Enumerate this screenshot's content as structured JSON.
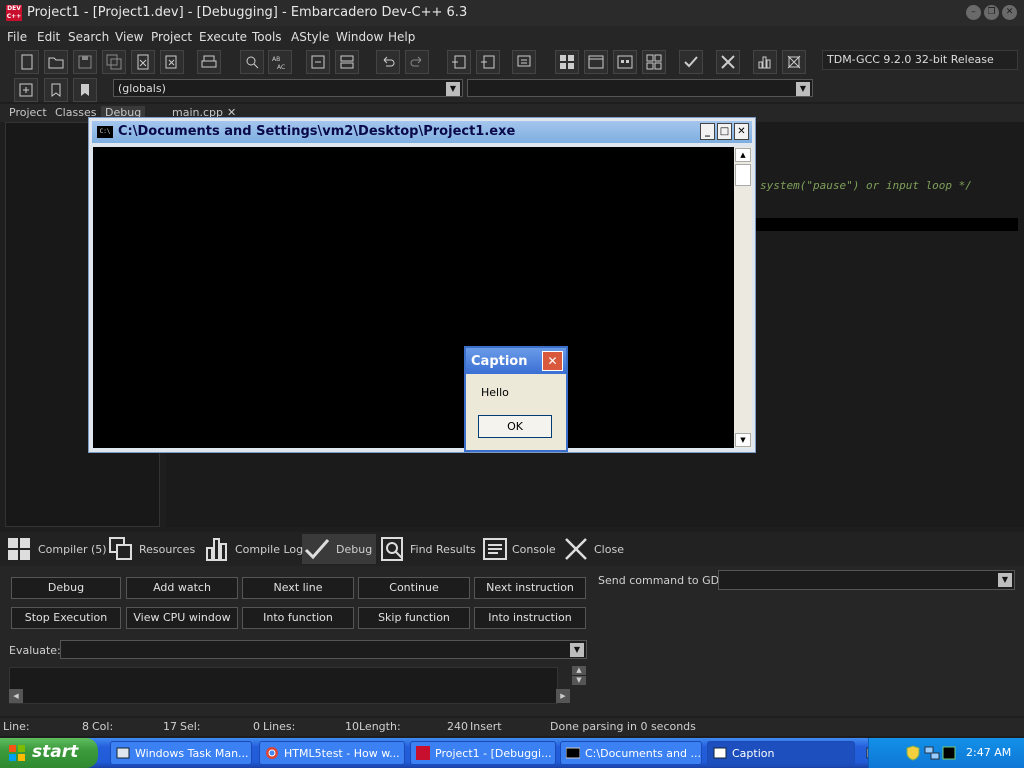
{
  "window": {
    "title": "Project1 - [Project1.dev] - [Debugging] - Embarcadero Dev-C++ 6.3",
    "app_icon_text": "DEV C++"
  },
  "menu": [
    "File",
    "Edit",
    "Search",
    "View",
    "Project",
    "Execute",
    "Tools",
    "AStyle",
    "Window",
    "Help"
  ],
  "toolbar": {
    "compiler": "TDM-GCC 9.2.0 32-bit Release",
    "scope": "(globals)"
  },
  "panel_tabs": [
    "Project",
    "Classes",
    "Debug"
  ],
  "editor": {
    "file_tab": "main.cpp",
    "code_fragment": "system(\"pause\") or input loop */"
  },
  "console": {
    "title": "C:\\Documents and Settings\\vm2\\Desktop\\Project1.exe",
    "icon_text": "C:\\"
  },
  "msgbox": {
    "title": "Caption",
    "text": "Hello",
    "ok": "OK"
  },
  "bottom_tabs": [
    "Compiler (5)",
    "Resources",
    "Compile Log",
    "Debug",
    "Find Results",
    "Console",
    "Close"
  ],
  "debug": {
    "buttons": [
      "Debug",
      "Add watch",
      "Next line",
      "Continue",
      "Next instruction",
      "Stop Execution",
      "View CPU window",
      "Into function",
      "Skip function",
      "Into instruction"
    ],
    "gdb_label": "Send command to GDB:",
    "evaluate_label": "Evaluate:"
  },
  "status": {
    "line": "Line:",
    "line_val": "8",
    "col": "Col:",
    "col_val": "17",
    "sel": "Sel:",
    "sel_val": "0",
    "lines": "Lines:",
    "lines_val": "10",
    "length": "Length:",
    "length_val": "240",
    "mode": "Insert",
    "message": "Done parsing in 0 seconds"
  },
  "taskbar": {
    "start": "start",
    "tasks": [
      "Windows Task Man...",
      "HTML5test - How w...",
      "Project1 - [Debuggi...",
      "C:\\Documents and ...",
      "Caption"
    ],
    "clock": "2:47 AM"
  },
  "colors": {
    "accent": "#3a6fd4",
    "console_bg": "#000000",
    "taskbar": "#245edb",
    "start": "#3c9a3c"
  }
}
